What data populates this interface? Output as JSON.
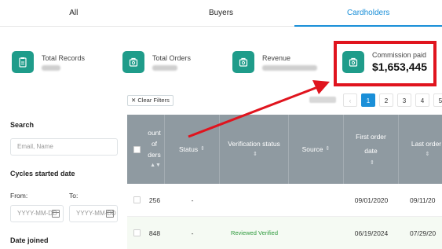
{
  "tabs": [
    "All",
    "Buyers",
    "Cardholders"
  ],
  "active_tab": "Cardholders",
  "stats": {
    "total_records": {
      "label": "Total Records"
    },
    "total_orders": {
      "label": "Total Orders"
    },
    "revenue": {
      "label": "Revenue"
    },
    "commission": {
      "label": "Commission paid",
      "value": "$1,653,445"
    }
  },
  "toolbar": {
    "clear_filters": "Clear Filters"
  },
  "pagination": {
    "prev": "‹",
    "pages": [
      "1",
      "2",
      "3",
      "4",
      "5"
    ],
    "active": "1"
  },
  "sidebar": {
    "search_title": "Search",
    "search_placeholder": "Email, Name",
    "cycles_title": "Cycles started date",
    "from_label": "From:",
    "to_label": "To:",
    "date_placeholder": "YYYY-MM-DD",
    "date_joined_title": "Date joined"
  },
  "table": {
    "headers": {
      "amount": "ount\nof\nders",
      "status": "Status",
      "verification": "Verification status",
      "source": "Source",
      "first_order": "First order\ndate",
      "last_order": "Last order"
    },
    "rows": [
      {
        "amount": "256",
        "status": "-",
        "verification": "",
        "source": "",
        "first_order": "09/01/2020",
        "last_order": "09/11/20"
      },
      {
        "amount": "848",
        "status": "-",
        "verification": "Reviewed Verified",
        "source": "",
        "first_order": "06/19/2024",
        "last_order": "07/29/20"
      }
    ]
  },
  "colors": {
    "accent": "#1a8fd8",
    "icon_bg": "#1f9c8a",
    "highlight": "#e0141e",
    "table_header": "#8f9aa1",
    "verified": "#2e9a3c"
  },
  "icons": [
    "clipboard-icon",
    "box-icon",
    "box-icon",
    "box-icon",
    "close-icon",
    "sort-icon",
    "calendar-icon"
  ]
}
